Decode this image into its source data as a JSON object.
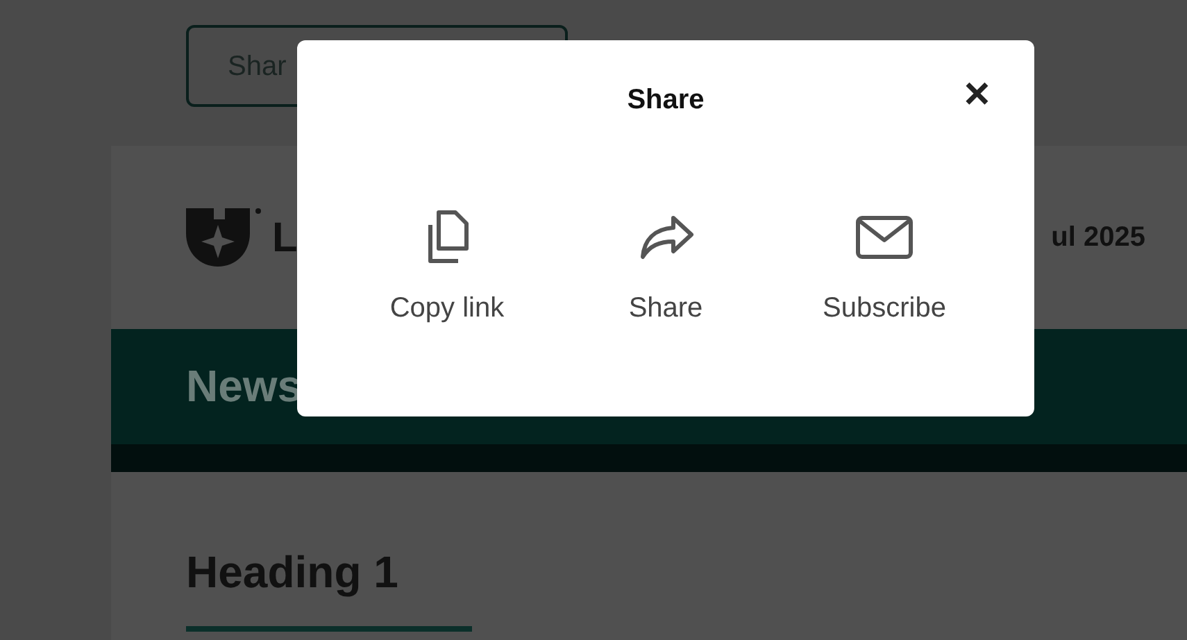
{
  "page": {
    "share_button": "Shar",
    "logo_text": "L",
    "date": "ul 2025",
    "banner_title": "News",
    "heading": "Heading 1"
  },
  "dialog": {
    "title": "Share",
    "close": "×",
    "actions": [
      {
        "kind": "copy",
        "label": "Copy link"
      },
      {
        "kind": "share",
        "label": "Share"
      },
      {
        "kind": "subscribe",
        "label": "Subscribe"
      }
    ]
  }
}
